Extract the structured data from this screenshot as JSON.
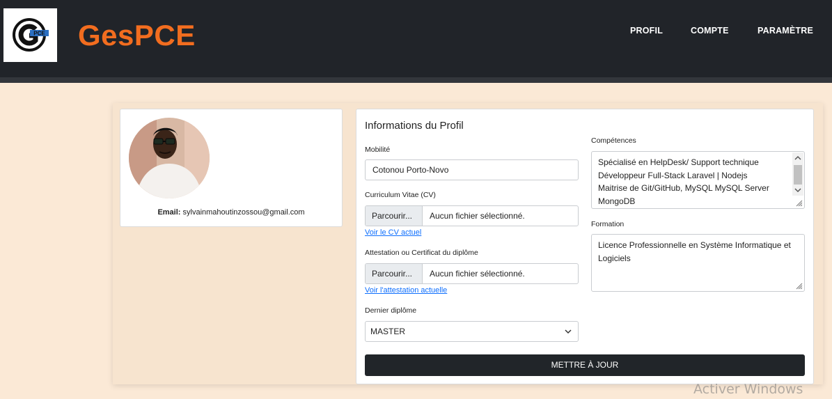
{
  "navbar": {
    "brand": "GesPCE",
    "logo_text": "PCE",
    "links": [
      "PROFIL",
      "COMPTE",
      "PARAMÈTRE"
    ]
  },
  "profile": {
    "email_label": "Email:",
    "email": "sylvainmahoutinzossou@gmail.com"
  },
  "form": {
    "title": "Informations du Profil",
    "mobility_label": "Mobilité",
    "mobility_value": "Cotonou Porto-Novo",
    "cv_label": "Curriculum Vitae (CV)",
    "cv_button": "Parcourir...",
    "cv_file": "Aucun fichier sélectionné.",
    "cv_link": "Voir le CV actuel",
    "attestation_label": "Attestation ou Certificat du diplôme",
    "attestation_button": "Parcourir...",
    "attestation_file": "Aucun fichier sélectionné.",
    "attestation_link": "Voir l'attestation actuelle",
    "diploma_label": "Dernier diplôme",
    "diploma_value": "MASTER",
    "skills_label": "Compétences",
    "skills_lines": [
      "Spécialisé en HelpDesk/ Support technique",
      "Développeur Full-Stack Laravel | Nodejs",
      "Maitrise de Git/GitHub, MySQL  MySQL Server",
      "MongoDB"
    ],
    "training_label": "Formation",
    "training_lines": [
      "Licence Professionnelle en Système Informatique et",
      "Logiciels"
    ],
    "submit": "METTRE À JOUR"
  },
  "os_watermark": "Activer Windows"
}
